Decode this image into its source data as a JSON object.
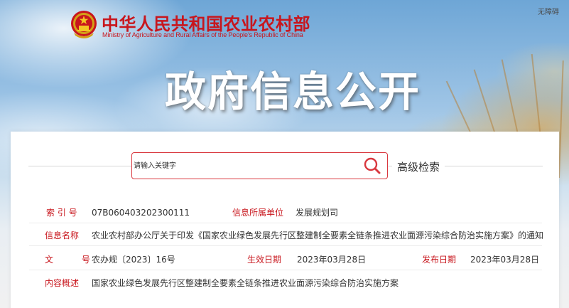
{
  "header": {
    "ministry_name_cn": "中华人民共和国农业农村部",
    "ministry_name_en": "Ministry of Agriculture and Rural Affairs of the People's Republic of China",
    "accessibility_label": "无障碍",
    "page_title": "政府信息公开"
  },
  "search": {
    "placeholder": "请输入关键字",
    "value": "",
    "advanced_label": "高级检索"
  },
  "info": {
    "index_label": "索 引 号",
    "index_value": "07B060403202300111",
    "unit_label": "信息所属单位",
    "unit_value": "发展规划司",
    "name_label": "信息名称",
    "name_value": "农业农村部办公厅关于印发《国家农业绿色发展先行区整建制全要素全链条推进农业面源污染综合防治实施方案》的通知",
    "doc_label": "文 号",
    "doc_value": "农办规〔2023〕16号",
    "effective_label": "生效日期",
    "effective_value": "2023年03月28日",
    "publish_label": "发布日期",
    "publish_value": "2023年03月28日",
    "summary_label": "内容概述",
    "summary_value": "国家农业绿色发展先行区整建制全要素全链条推进农业面源污染综合防治实施方案"
  },
  "colors": {
    "brand_red": "#c8161d",
    "search_border": "#d9383f"
  },
  "icons": {
    "emblem": "national-emblem-icon",
    "search": "search-icon"
  }
}
